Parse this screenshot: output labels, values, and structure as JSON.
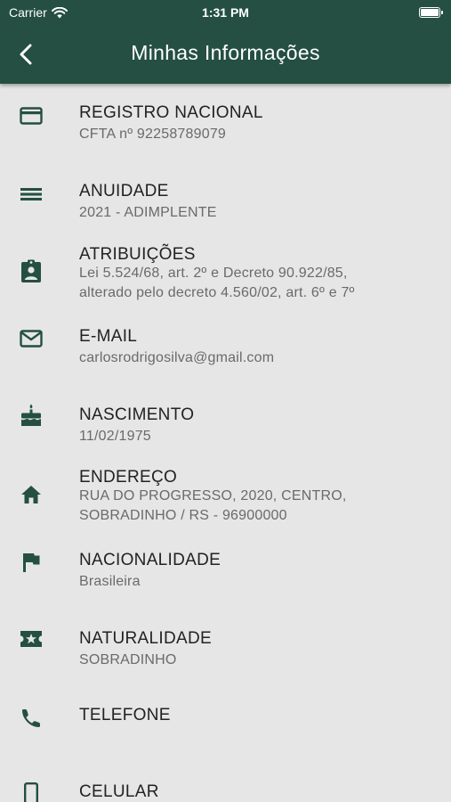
{
  "status_bar": {
    "carrier": "Carrier",
    "time": "1:31 PM"
  },
  "header": {
    "title": "Minhas Informações",
    "back_icon": "chevron-left-icon"
  },
  "colors": {
    "header_bg": "#244f42",
    "icon": "#244f42",
    "background": "#e6e6e6",
    "label": "#222222",
    "value": "#6a6a6a"
  },
  "items": [
    {
      "icon": "credit-card-icon",
      "label": "REGISTRO NACIONAL",
      "value": "CFTA nº 92258789079"
    },
    {
      "icon": "list-icon",
      "label": "ANUIDADE",
      "value": "2021 - ADIMPLENTE"
    },
    {
      "icon": "assignment-ind-icon",
      "label": "ATRIBUIÇÕES",
      "value": "Lei 5.524/68, art. 2º e Decreto 90.922/85,",
      "value2": "alterado pelo decreto 4.560/02, art. 6º e 7º"
    },
    {
      "icon": "mail-icon",
      "label": "E-MAIL",
      "value": "carlosrodrigosilva@gmail.com"
    },
    {
      "icon": "cake-icon",
      "label": "NASCIMENTO",
      "value": "11/02/1975"
    },
    {
      "icon": "home-icon",
      "label": "ENDEREÇO",
      "value": "RUA DO PROGRESSO, 2020, CENTRO,",
      "value2": "SOBRADINHO / RS - 96900000"
    },
    {
      "icon": "flag-icon",
      "label": "NACIONALIDADE",
      "value": "Brasileira"
    },
    {
      "icon": "local-activity-icon",
      "label": "NATURALIDADE",
      "value": "SOBRADINHO"
    },
    {
      "icon": "phone-icon",
      "label": "TELEFONE"
    },
    {
      "icon": "smartphone-icon",
      "label": "CELULAR"
    }
  ]
}
